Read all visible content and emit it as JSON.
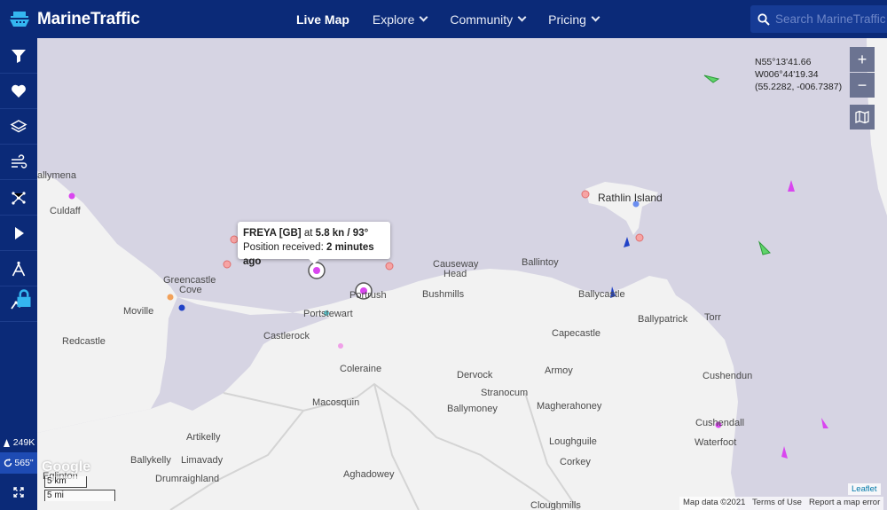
{
  "app": {
    "title": "MarineTraffic"
  },
  "nav": {
    "items": [
      {
        "label": "Live Map",
        "active": true
      },
      {
        "label": "Explore",
        "active": false
      },
      {
        "label": "Community",
        "active": false
      },
      {
        "label": "Pricing",
        "active": false
      }
    ]
  },
  "search": {
    "placeholder": "Search MarineTraffic"
  },
  "sidebar": {
    "buttons": [
      "filter-icon",
      "heart-icon",
      "layers-icon",
      "wind-icon",
      "network-icon",
      "play-icon",
      "compass-icon",
      "chart-line-icon"
    ],
    "vessel_count": "249K",
    "refresh_seconds": "565\""
  },
  "map": {
    "coords": {
      "lat_dms": "N55°13'41.66",
      "lon_dms": "W006°44'19.34",
      "decimal": "(55.2282, -006.7387)"
    },
    "zoom_in": "+",
    "zoom_out": "−",
    "places": [
      {
        "name": "allymena",
        "kind": "town"
      },
      {
        "name": "Culdaff",
        "kind": "town"
      },
      {
        "name": "Greencastle",
        "kind": "town"
      },
      {
        "name": "Cove",
        "kind": "town"
      },
      {
        "name": "Moville",
        "kind": "town"
      },
      {
        "name": "Redcastle",
        "kind": "town"
      },
      {
        "name": "Rathlin Island",
        "kind": "island"
      },
      {
        "name": "Causeway",
        "kind": "town"
      },
      {
        "name": "Head",
        "kind": "town"
      },
      {
        "name": "Ballintoy",
        "kind": "town"
      },
      {
        "name": "Portrush",
        "kind": "town"
      },
      {
        "name": "Bushmills",
        "kind": "town"
      },
      {
        "name": "Ballycastle",
        "kind": "town"
      },
      {
        "name": "Portstewart",
        "kind": "town"
      },
      {
        "name": "Ballypatrick",
        "kind": "town"
      },
      {
        "name": "Torr",
        "kind": "town"
      },
      {
        "name": "Castlerock",
        "kind": "town"
      },
      {
        "name": "Capecastle",
        "kind": "town"
      },
      {
        "name": "Coleraine",
        "kind": "town"
      },
      {
        "name": "Armoy",
        "kind": "town"
      },
      {
        "name": "Dervock",
        "kind": "town"
      },
      {
        "name": "Cushendun",
        "kind": "town"
      },
      {
        "name": "Stranocum",
        "kind": "town"
      },
      {
        "name": "Macosquin",
        "kind": "town"
      },
      {
        "name": "Magherahoney",
        "kind": "town"
      },
      {
        "name": "Cushendall",
        "kind": "town"
      },
      {
        "name": "Ballymoney",
        "kind": "town"
      },
      {
        "name": "Waterfoot",
        "kind": "town"
      },
      {
        "name": "Artikelly",
        "kind": "town"
      },
      {
        "name": "Loughguile",
        "kind": "town"
      },
      {
        "name": "Ballykelly",
        "kind": "town"
      },
      {
        "name": "Limavady",
        "kind": "town"
      },
      {
        "name": "Corkey",
        "kind": "town"
      },
      {
        "name": "Drumraighland",
        "kind": "town"
      },
      {
        "name": "Aghadowey",
        "kind": "town"
      },
      {
        "name": "Eglinton",
        "kind": "town"
      },
      {
        "name": "Cloughmills",
        "kind": "town"
      }
    ]
  },
  "tooltip": {
    "vessel": "FREYA [GB]",
    "at": "at",
    "speed_course": "5.8 kn / 93°",
    "position_label": "Position received:",
    "position_time": "2 minutes ago"
  },
  "footer": {
    "scale_km": "5 km",
    "scale_mi": "5 mi",
    "google": "Google",
    "map_data": "Map data ©2021",
    "terms": "Terms of Use",
    "report": "Report a map error",
    "leaflet": "Leaflet"
  },
  "colors": {
    "nav_bg": "#0b2a78",
    "sea": "#d6d4e3",
    "land": "#f2f2f2",
    "search_bg": "#163b95"
  }
}
